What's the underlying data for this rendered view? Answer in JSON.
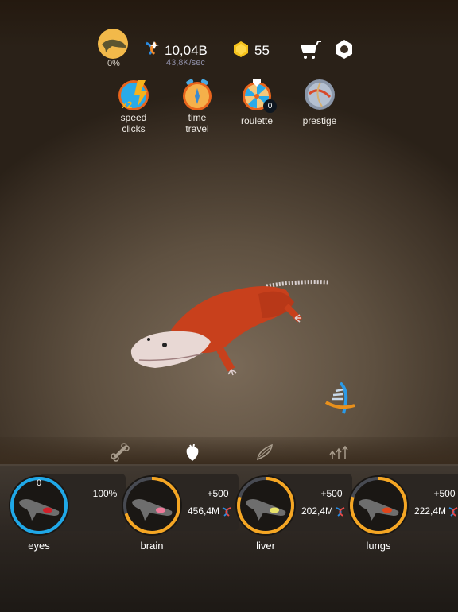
{
  "hud": {
    "evolution_progress": "0%",
    "dna_amount": "10,04B",
    "dna_rate": "43,8K/sec",
    "gems": "55",
    "icons": [
      "whale-icon",
      "dna-icon",
      "gem-icon",
      "cart-icon",
      "settings-icon"
    ]
  },
  "actions": [
    {
      "label_line1": "speed",
      "label_line2": "clicks",
      "icon": "speed-clicks-icon"
    },
    {
      "label_line1": "time",
      "label_line2": "travel",
      "icon": "alarm-clock-icon"
    },
    {
      "label_line1": "roulette",
      "label_line2": "",
      "icon": "roulette-wheel-icon",
      "badge": "0"
    },
    {
      "label_line1": "prestige",
      "label_line2": "",
      "icon": "prestige-dna-icon"
    }
  ],
  "tabs": [
    {
      "name": "skeleton",
      "icon": "bone-icon",
      "active": false
    },
    {
      "name": "organs",
      "icon": "heart-icon",
      "active": true
    },
    {
      "name": "muscles",
      "icon": "muscle-icon",
      "active": false
    },
    {
      "name": "upgrades",
      "icon": "arrows-up-icon",
      "active": false
    }
  ],
  "organs": [
    {
      "name": "eyes",
      "level": "0",
      "status": "100%",
      "progress": 1.0,
      "color": "#1fa8e8",
      "highlight": "#d0202a"
    },
    {
      "name": "brain",
      "plus": "+500",
      "cost": "456,4M",
      "progress": 0.7,
      "color": "#f5a623",
      "highlight": "#ef7a9a"
    },
    {
      "name": "liver",
      "plus": "+500",
      "cost": "202,4M",
      "progress": 0.8,
      "color": "#f5a623",
      "highlight": "#e8e36a"
    },
    {
      "name": "lungs",
      "plus": "+500",
      "cost": "222,4M",
      "progress": 0.8,
      "color": "#f5a623",
      "highlight": "#e0461c"
    }
  ]
}
